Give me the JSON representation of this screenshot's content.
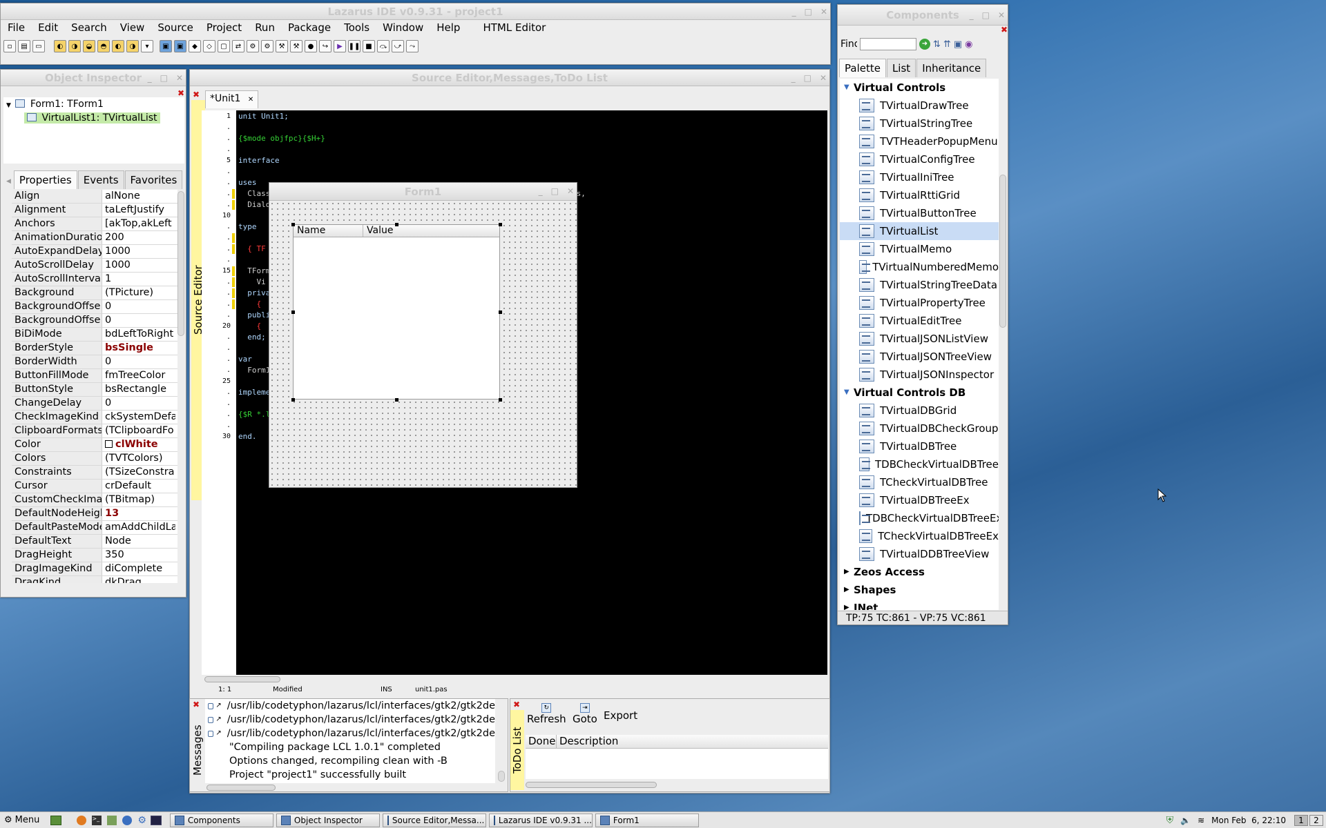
{
  "ide": {
    "title": "Lazarus IDE v0.9.31 - project1",
    "menus": [
      "File",
      "Edit",
      "Search",
      "View",
      "Source",
      "Project",
      "Run",
      "Package",
      "Tools",
      "Window",
      "Help",
      "HTML Editor"
    ]
  },
  "components": {
    "title": "Components",
    "find_label": "Find",
    "tabs": [
      "Palette",
      "List",
      "Inheritance"
    ],
    "groups": [
      {
        "name": "Virtual Controls",
        "expanded": true,
        "items": [
          "TVirtualDrawTree",
          "TVirtualStringTree",
          "TVTHeaderPopupMenu",
          "TVirtualConfigTree",
          "TVirtualIniTree",
          "TVirtualRttiGrid",
          "TVirtualButtonTree",
          "TVirtualList",
          "TVirtualMemo",
          "TVirtualNumberedMemo",
          "TVirtualStringTreeData",
          "TVirtualPropertyTree",
          "TVirtualEditTree",
          "TVirtualJSONListView",
          "TVirtualJSONTreeView",
          "TVirtualJSONInspector"
        ]
      },
      {
        "name": "Virtual Controls DB",
        "expanded": true,
        "items": [
          "TVirtualDBGrid",
          "TVirtualDBCheckGroup",
          "TVirtualDBTree",
          "TDBCheckVirtualDBTree",
          "TCheckVirtualDBTree",
          "TVirtualDBTreeEx",
          "TDBCheckVirtualDBTreeEx",
          "TCheckVirtualDBTreeEx",
          "TVirtualDDBTreeView"
        ]
      },
      {
        "name": "Zeos Access",
        "expanded": false,
        "items": []
      },
      {
        "name": "Shapes",
        "expanded": false,
        "items": []
      },
      {
        "name": "INet",
        "expanded": false,
        "items": []
      }
    ],
    "selected_item": "TVirtualList",
    "status": "TP:75 TC:861 - VP:75 VC:861"
  },
  "inspector": {
    "title": "Object Inspector",
    "tree": {
      "root": "Form1: TForm1",
      "child": "VirtualList1: TVirtualList"
    },
    "tabs": [
      "Properties",
      "Events",
      "Favorites"
    ],
    "properties": [
      {
        "name": "Align",
        "value": "alNone"
      },
      {
        "name": "Alignment",
        "value": "taLeftJustify"
      },
      {
        "name": "Anchors",
        "value": "[akTop,akLeft",
        "expandable": true
      },
      {
        "name": "AnimationDuratio",
        "value": "200"
      },
      {
        "name": "AutoExpandDelay",
        "value": "1000"
      },
      {
        "name": "AutoScrollDelay",
        "value": "1000"
      },
      {
        "name": "AutoScrollInterva",
        "value": "1"
      },
      {
        "name": "Background",
        "value": "(TPicture)"
      },
      {
        "name": "BackgroundOffse",
        "value": "0"
      },
      {
        "name": "BackgroundOffse",
        "value": "0"
      },
      {
        "name": "BiDiMode",
        "value": "bdLeftToRight"
      },
      {
        "name": "BorderStyle",
        "value": "bsSingle",
        "bold": true
      },
      {
        "name": "BorderWidth",
        "value": "0"
      },
      {
        "name": "ButtonFillMode",
        "value": "fmTreeColor"
      },
      {
        "name": "ButtonStyle",
        "value": "bsRectangle"
      },
      {
        "name": "ChangeDelay",
        "value": "0"
      },
      {
        "name": "CheckImageKind",
        "value": "ckSystemDefa"
      },
      {
        "name": "ClipboardFormats",
        "value": "(TClipboardFo"
      },
      {
        "name": "Color",
        "value": "clWhite",
        "bold": true,
        "swatch": true
      },
      {
        "name": "Colors",
        "value": "(TVTColors)",
        "expandable": true
      },
      {
        "name": "Constraints",
        "value": "(TSizeConstra",
        "expandable": true
      },
      {
        "name": "Cursor",
        "value": "crDefault"
      },
      {
        "name": "CustomCheckIma",
        "value": "(TBitmap)"
      },
      {
        "name": "DefaultNodeHeigl",
        "value": "13",
        "bold": true
      },
      {
        "name": "DefaultPasteMode",
        "value": "amAddChildLa"
      },
      {
        "name": "DefaultText",
        "value": "Node"
      },
      {
        "name": "DragHeight",
        "value": "350"
      },
      {
        "name": "DragImageKind",
        "value": "diComplete"
      },
      {
        "name": "DragKind",
        "value": "dkDrag"
      }
    ]
  },
  "source_editor": {
    "title": "Source Editor,Messages,ToDo List",
    "tab": "*Unit1",
    "vertical_label": "Source Editor",
    "gutter": [
      "1",
      ".",
      ".",
      ".",
      "5",
      ".",
      ".",
      ".",
      ".",
      "10",
      ".",
      ".",
      ".",
      ".",
      "15",
      ".",
      ".",
      ".",
      ".",
      "20",
      ".",
      ".",
      ".",
      ".",
      "25",
      ".",
      ".",
      ".",
      ".",
      "30"
    ],
    "lines": [
      {
        "n": 0,
        "text": "unit Unit1;",
        "color": "#b0d8ff"
      },
      {
        "n": 2,
        "text": "{$mode objfpc}{$H+}",
        "color": "#35d035"
      },
      {
        "n": 4,
        "text": "interface",
        "color": "#b0d8ff"
      },
      {
        "n": 6,
        "text": "uses",
        "color": "#b0d8ff"
      },
      {
        "n": 7,
        "text": "  Class",
        "color": "#d0d0d0"
      },
      {
        "n": 8,
        "text": "  Dialo",
        "color": "#d0d0d0"
      },
      {
        "n": 10,
        "text": "type",
        "color": "#b0d8ff"
      },
      {
        "n": 12,
        "text": "  { TF",
        "color": "#ff3b3b"
      },
      {
        "n": 14,
        "text": "  TForm",
        "color": "#d0d0d0"
      },
      {
        "n": 15,
        "text": "    Vi",
        "color": "#d0d0d0"
      },
      {
        "n": 16,
        "text": "  priva",
        "color": "#b0d8ff"
      },
      {
        "n": 17,
        "text": "    { ",
        "color": "#ff3b3b"
      },
      {
        "n": 18,
        "text": "  publi",
        "color": "#b0d8ff"
      },
      {
        "n": 19,
        "text": "    { ",
        "color": "#ff3b3b"
      },
      {
        "n": 20,
        "text": "  end;",
        "color": "#b0d8ff"
      },
      {
        "n": 22,
        "text": "var",
        "color": "#b0d8ff"
      },
      {
        "n": 23,
        "text": "  Form1",
        "color": "#d0d0d0"
      },
      {
        "n": 25,
        "text": "impleme",
        "color": "#b0d8ff"
      },
      {
        "n": 27,
        "text": "{$R *.l",
        "color": "#35d035"
      },
      {
        "n": 29,
        "text": "end.",
        "color": "#b0d8ff"
      }
    ],
    "line_tail": "cs,",
    "status": {
      "pos": "1:  1",
      "state": "Modified",
      "mode": "INS",
      "file": "unit1.pas"
    }
  },
  "form_designer": {
    "title": "Form1",
    "columns": [
      "Name",
      "Value"
    ]
  },
  "messages": {
    "label": "Messages",
    "lines": [
      "/usr/lib/codetyphon/lazarus/lcl/interfaces/gtk2/gtk2de",
      "/usr/lib/codetyphon/lazarus/lcl/interfaces/gtk2/gtk2de",
      "/usr/lib/codetyphon/lazarus/lcl/interfaces/gtk2/gtk2de",
      "\"Compiling package LCL 1.0.1\" completed",
      "Options changed, recompiling clean with -B",
      "Project \"project1\" successfully built"
    ]
  },
  "todo": {
    "label": "ToDo List",
    "buttons": [
      "Refresh",
      "Goto",
      "Export"
    ],
    "columns": [
      "Done",
      "Description"
    ]
  },
  "taskbar": {
    "menu": "Menu",
    "tasks": [
      "Components",
      "Object Inspector",
      "Source Editor,Messa...",
      "Lazarus IDE v0.9.31 ...",
      "Form1"
    ],
    "clock": "Mon Feb  6, 22:10",
    "workspaces": [
      "1",
      "2"
    ]
  }
}
